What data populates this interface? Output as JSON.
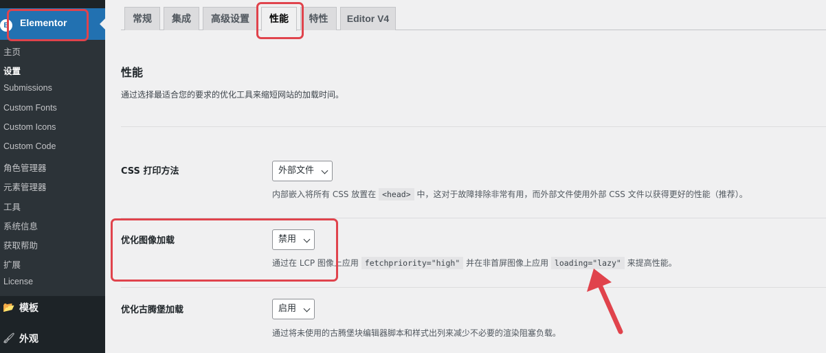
{
  "sidebar": {
    "active_label": "Elementor",
    "items": [
      {
        "label": "主页"
      },
      {
        "label": "设置"
      },
      {
        "label": "Submissions"
      },
      {
        "label": "Custom Fonts"
      },
      {
        "label": "Custom Icons"
      },
      {
        "label": "Custom Code"
      },
      {
        "label": "角色管理器"
      },
      {
        "label": "元素管理器"
      },
      {
        "label": "工具"
      },
      {
        "label": "系统信息"
      },
      {
        "label": "获取帮助"
      },
      {
        "label": "扩展"
      },
      {
        "label": "License"
      }
    ],
    "current_item": "设置",
    "main_items": [
      {
        "label": "模板",
        "icon": "folder-icon"
      },
      {
        "label": "外观",
        "icon": "paintbrush-icon"
      }
    ]
  },
  "tabs": [
    {
      "label": "常规"
    },
    {
      "label": "集成"
    },
    {
      "label": "高级设置"
    },
    {
      "label": "性能"
    },
    {
      "label": "特性"
    },
    {
      "label": "Editor V4"
    }
  ],
  "active_tab": "性能",
  "section": {
    "title": "性能",
    "description": "通过选择最适合您的要求的优化工具来缩短网站的加载时间。"
  },
  "settings": [
    {
      "label": "CSS 打印方法",
      "value": "外部文件",
      "desc_1": "内部嵌入将所有 CSS 放置在",
      "code_1": "<head>",
      "desc_2": "中，这对于故障排除非常有用，而外部文件使用外部 CSS 文件以获得更好的性能（推荐）。"
    },
    {
      "label": "优化图像加载",
      "value": "禁用",
      "desc_1": "通过在 LCP 图像上应用",
      "code_1": "fetchpriority=\"high\"",
      "desc_2": "并在非首屏图像上应用",
      "code_2": "loading=\"lazy\"",
      "desc_3": "来提高性能。"
    },
    {
      "label": "优化古腾堡加载",
      "value": "启用",
      "desc_1": "通过将未使用的古腾堡块编辑器脚本和样式出列来减少不必要的渲染阻塞负载。"
    }
  ],
  "colors": {
    "highlight": "#e0434c",
    "sidebar_bg": "#1d2327",
    "active_menu": "#2271b1"
  }
}
